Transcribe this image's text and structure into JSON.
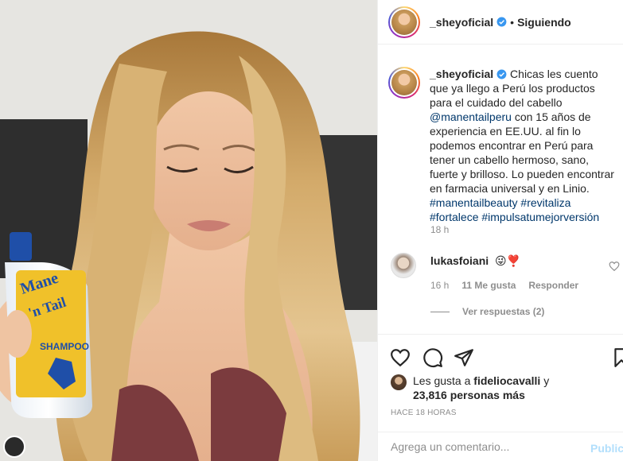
{
  "post": {
    "username": "_sheyoficial",
    "follow_status": "Siguiendo",
    "separator": "•",
    "caption_text": "Chicas les cuento que ya llego a Perú los productos para el cuidado del cabello",
    "caption_mention": "@manentailperu",
    "caption_text2": "con 15 años de experiencia en EE.UU. al fin lo podemos encontrar en Perú para tener un cabello hermoso, sano, fuerte y brilloso. Lo pueden encontrar en farmacia universal y en Linio.",
    "hashtags": [
      "#manentailbeauty",
      "#revitaliza",
      "#fortalece",
      "#impulsatumejorversión"
    ],
    "caption_time": "18 h"
  },
  "comment": {
    "username": "lukasfoiani",
    "text": "😜❣️",
    "time": "16 h",
    "likes": "11 Me gusta",
    "reply_label": "Responder",
    "view_replies": "Ver respuestas (2)"
  },
  "likes": {
    "prefix": "Les gusta a",
    "user": "fideliocavalli",
    "connector": "y",
    "count": "23,816 personas más"
  },
  "time_ago": "HACE 18 HORAS",
  "add_comment": {
    "placeholder": "Agrega un comentario...",
    "publish_label": "Publicar"
  },
  "colors": {
    "verified": "#3897f0",
    "link": "#00376b",
    "muted": "#8e8e8e",
    "publish_disabled": "#b2dffc"
  },
  "icons": [
    "verified-badge-icon",
    "heart-icon",
    "comment-icon",
    "share-icon",
    "bookmark-icon"
  ]
}
